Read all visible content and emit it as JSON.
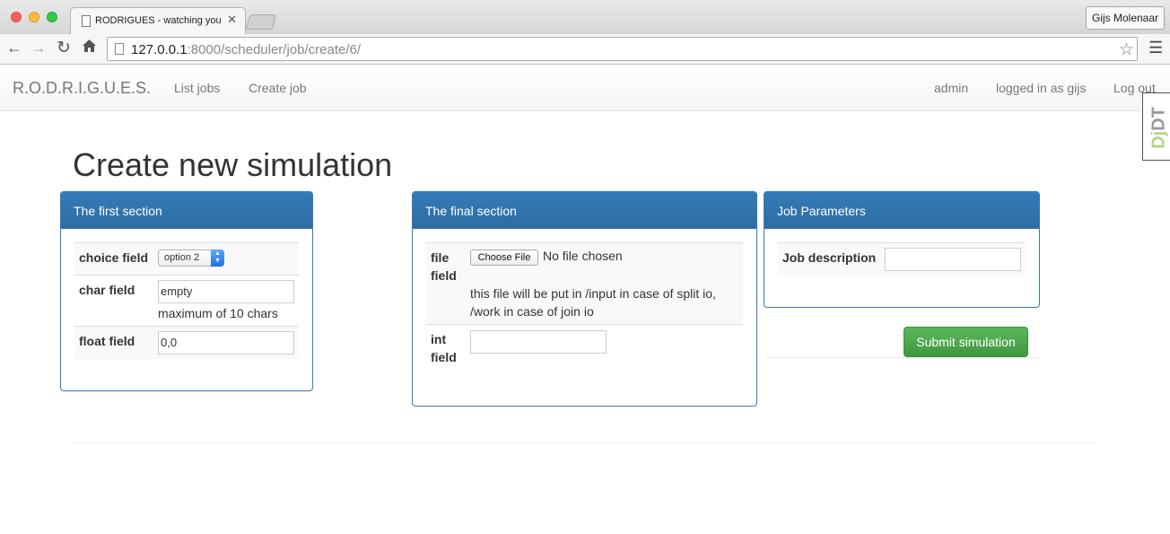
{
  "browser": {
    "tab_title": "RODRIGUES - watching you",
    "tab_close": "✕",
    "profile": "Gijs Molenaar",
    "url_host": "127.0.0.1",
    "url_rest": ":8000/scheduler/job/create/6/",
    "icons": {
      "back": "back-arrow-icon",
      "forward": "forward-arrow-icon",
      "reload": "reload-icon",
      "home": "home-icon",
      "star": "bookmark-star-icon",
      "menu": "hamburger-menu-icon"
    }
  },
  "navbar": {
    "brand": "R.O.D.R.I.G.U.E.S.",
    "links": [
      "List jobs",
      "Create job"
    ],
    "right_links": [
      "admin",
      "logged in as gijs",
      "Log out"
    ]
  },
  "djdt": {
    "dj": "Dj",
    "dt": "DT"
  },
  "page": {
    "title": "Create new simulation"
  },
  "first_section": {
    "heading": "The first section",
    "choice_label": "choice field",
    "choice_value": "option 2",
    "char_label": "char field",
    "char_value": "empty",
    "char_help": "maximum of 10 chars",
    "float_label": "float field",
    "float_value": "0,0"
  },
  "final_section": {
    "heading": "The final section",
    "file_label_1": "file",
    "file_label_2": "field",
    "choose_button": "Choose File",
    "no_file": "No file chosen",
    "file_help_1": "this file will be put in /input in case of split io,",
    "file_help_2": "/work in case of join io",
    "int_label_1": "int",
    "int_label_2": "field",
    "int_value": ""
  },
  "job_parameters": {
    "heading": "Job Parameters",
    "description_label": "Job description",
    "description_value": ""
  },
  "submit_label": "Submit simulation",
  "colors": {
    "panel_primary": "#337ab7",
    "submit_green": "#5cb85c",
    "djdt_green": "#b4d589"
  }
}
